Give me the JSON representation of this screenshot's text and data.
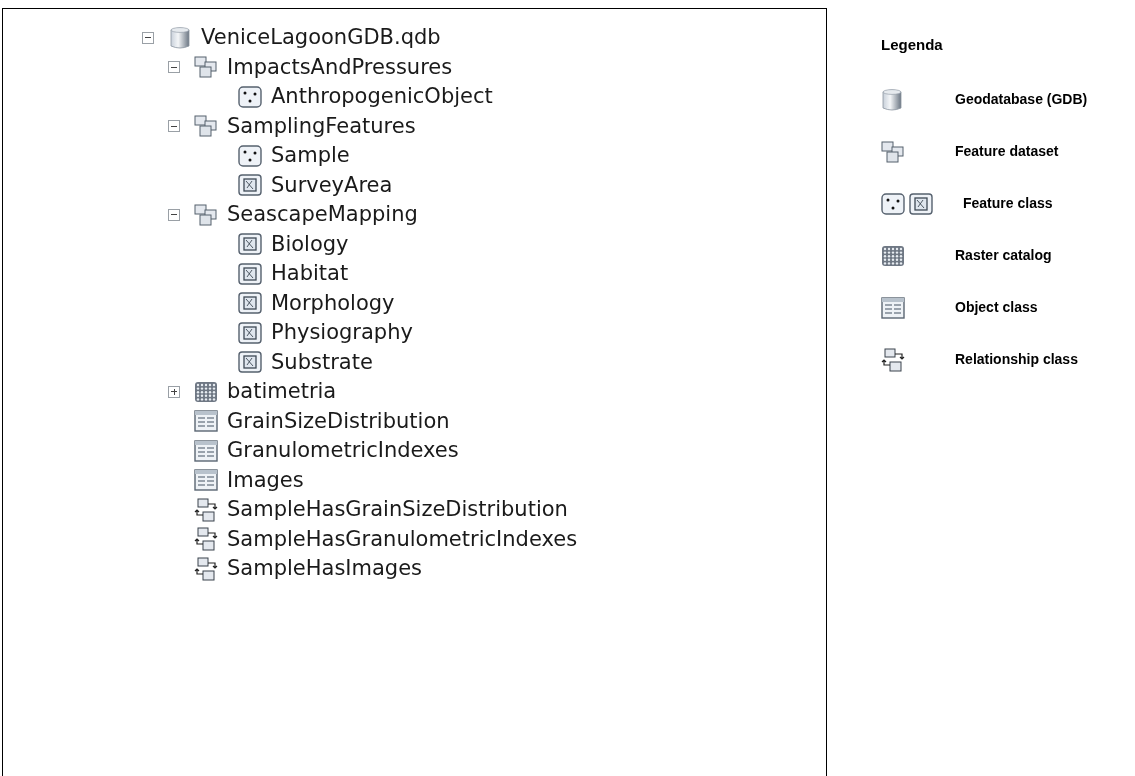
{
  "tree": {
    "label": "VeniceLagoonGDB.qdb",
    "kind": "geodatabase",
    "expanded": true,
    "children": [
      {
        "label": "ImpactsAndPressures",
        "kind": "feature_dataset",
        "expanded": true,
        "children": [
          {
            "label": "AnthropogenicObject",
            "kind": "point_feature_class"
          }
        ]
      },
      {
        "label": "SamplingFeatures",
        "kind": "feature_dataset",
        "expanded": true,
        "children": [
          {
            "label": "Sample",
            "kind": "point_feature_class"
          },
          {
            "label": "SurveyArea",
            "kind": "polygon_feature_class"
          }
        ]
      },
      {
        "label": "SeascapeMapping",
        "kind": "feature_dataset",
        "expanded": true,
        "children": [
          {
            "label": "Biology",
            "kind": "polygon_feature_class"
          },
          {
            "label": "Habitat",
            "kind": "polygon_feature_class"
          },
          {
            "label": "Morphology",
            "kind": "polygon_feature_class"
          },
          {
            "label": "Physiography",
            "kind": "polygon_feature_class"
          },
          {
            "label": "Substrate",
            "kind": "polygon_feature_class"
          }
        ]
      },
      {
        "label": "batimetria",
        "kind": "raster_catalog",
        "expanded": false
      },
      {
        "label": "GrainSizeDistribution",
        "kind": "table"
      },
      {
        "label": "GranulometricIndexes",
        "kind": "table"
      },
      {
        "label": "Images",
        "kind": "table"
      },
      {
        "label": "SampleHasGrainSizeDistribution",
        "kind": "relationship_class"
      },
      {
        "label": "SampleHasGranulometricIndexes",
        "kind": "relationship_class"
      },
      {
        "label": "SampleHasImages",
        "kind": "relationship_class"
      }
    ]
  },
  "legend": {
    "title": "Legenda",
    "items": [
      {
        "kind": "geodatabase",
        "label": "Geodatabase (GDB)"
      },
      {
        "kind": "feature_dataset",
        "label": "Feature dataset"
      },
      {
        "kind": "feature_class",
        "label": "Feature class"
      },
      {
        "kind": "raster_catalog",
        "label": "Raster catalog"
      },
      {
        "kind": "table",
        "label": "Object class"
      },
      {
        "kind": "relationship_class",
        "label": "Relationship class"
      }
    ]
  }
}
